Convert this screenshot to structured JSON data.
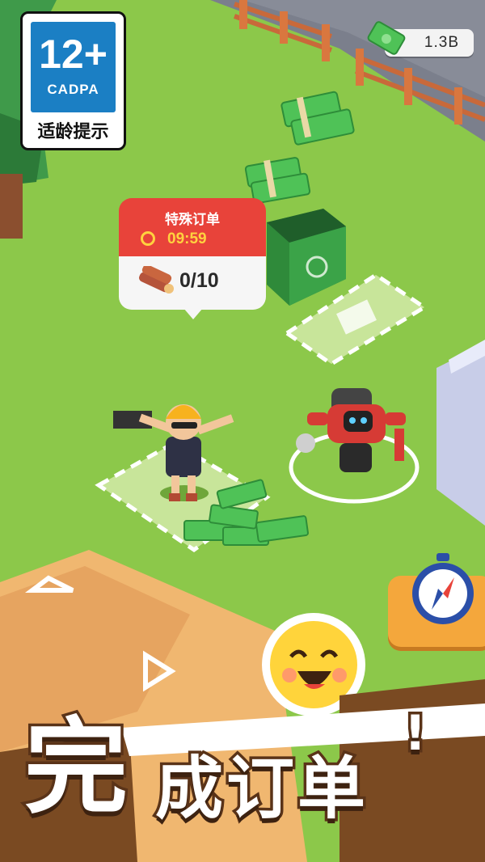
{
  "rating": {
    "age": "12+",
    "org": "CADPA",
    "tip": "适龄提示"
  },
  "currency": {
    "value": "1.3B",
    "icon": "cash-icon"
  },
  "order": {
    "title": "特殊订单",
    "timer": "09:59",
    "progress": "0/10",
    "item_icon": "wood-logs-icon"
  },
  "banner": {
    "first": "完",
    "rest": "成订单",
    "exclaim": "!"
  },
  "buttons": {
    "compass": "compass-icon"
  },
  "colors": {
    "grass": "#8cc84a",
    "order_red": "#e8433a",
    "timer_yellow": "#ffd23f",
    "button_orange": "#f4a73c",
    "banner_brown": "#5a3318"
  }
}
